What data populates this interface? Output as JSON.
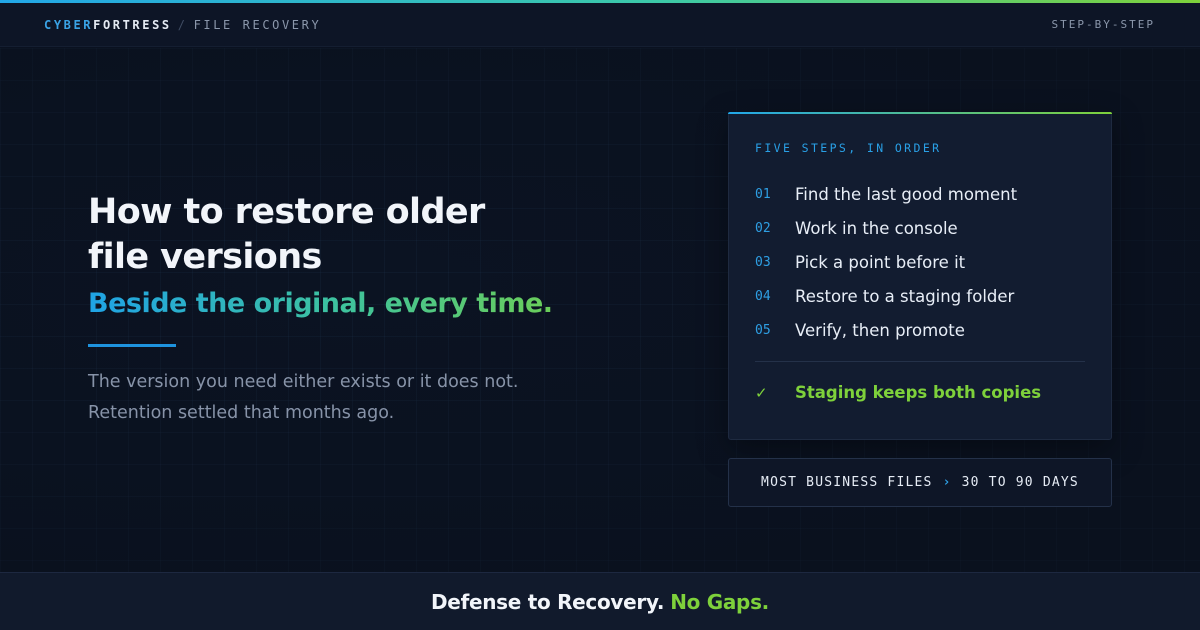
{
  "header": {
    "brand_part1": "CYBER",
    "brand_part2": "FORTRESS",
    "separator": "/",
    "section": "FILE RECOVERY",
    "right_label": "STEP-BY-STEP"
  },
  "hero": {
    "title": "How to restore older file versions",
    "subtitle": "Beside the original, every time.",
    "body_line1": "The version you need either exists or it does not.",
    "body_line2": "Retention settled that months ago."
  },
  "steps_card": {
    "heading": "FIVE STEPS, IN ORDER",
    "steps": [
      {
        "num": "01",
        "label": "Find the last good moment"
      },
      {
        "num": "02",
        "label": "Work in the console"
      },
      {
        "num": "03",
        "label": "Pick a point before it"
      },
      {
        "num": "04",
        "label": "Restore to a staging folder"
      },
      {
        "num": "05",
        "label": "Verify, then promote"
      }
    ],
    "check_icon": "✓",
    "check_label": "Staging keeps both copies"
  },
  "retention": {
    "label": "MOST BUSINESS FILES",
    "arrow": "›",
    "value": "30 TO 90 DAYS"
  },
  "footer": {
    "text": "Defense to Recovery.",
    "accent": "No Gaps."
  },
  "colors": {
    "accent_blue": "#2e9fe4",
    "accent_green": "#7ed13b",
    "background": "#0a1120"
  }
}
